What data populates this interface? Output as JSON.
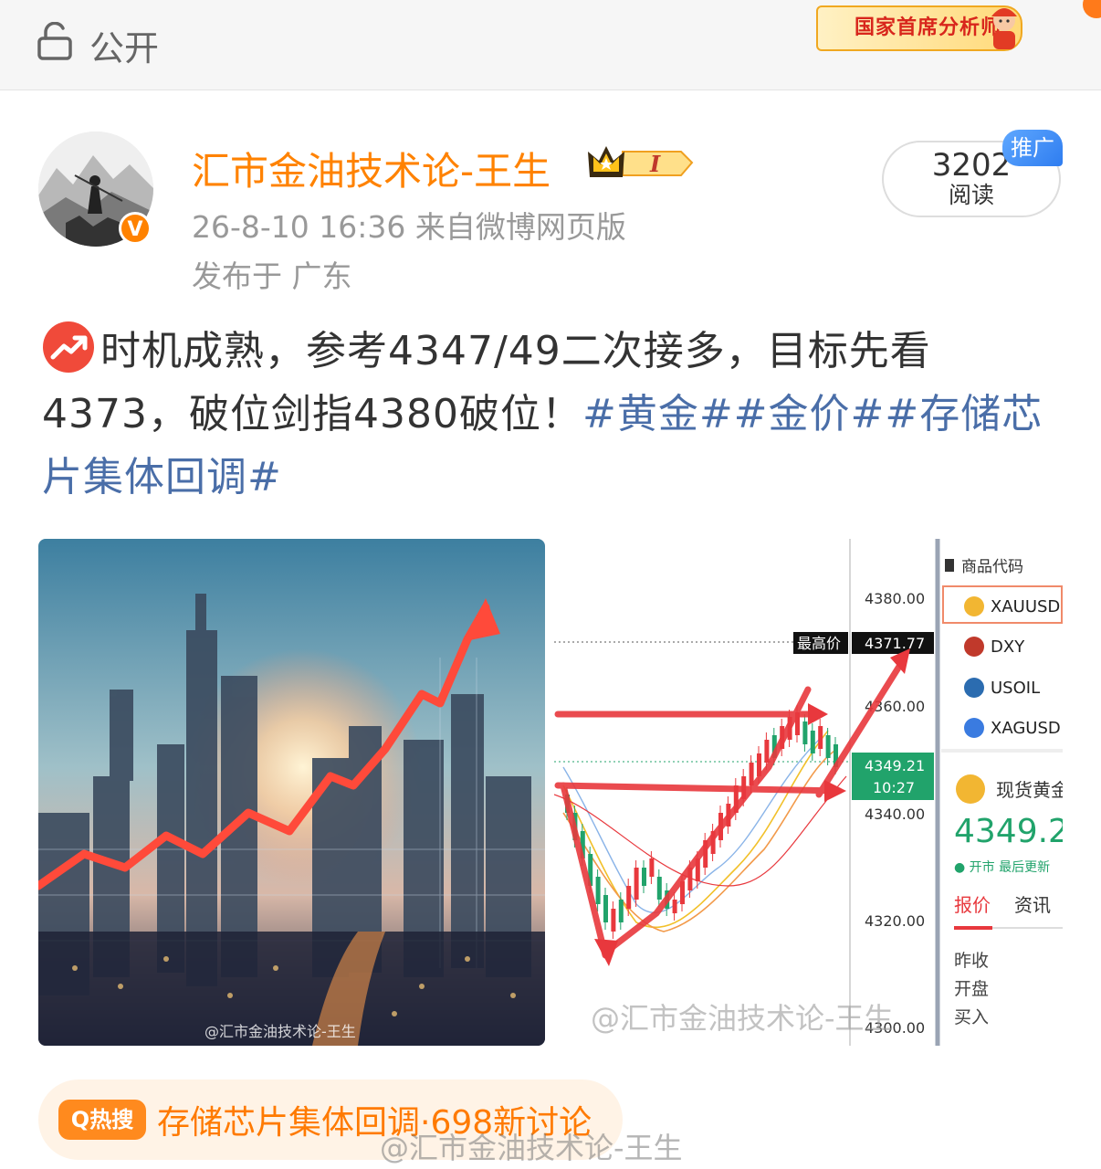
{
  "topbar": {
    "visibility_label": "公开",
    "rank_banner": "国家首席分析师"
  },
  "author": {
    "name": "汇市金油技术论-王生",
    "vip_level": "I",
    "time_source": "26-8-10 16:36  来自微博网页版",
    "location": "发布于 广东"
  },
  "read_stats": {
    "count": "3202",
    "label": "阅读",
    "promo_tag": "推广"
  },
  "post": {
    "text": "时机成熟，参考4347/49二次接多，目标先看4373，破位剑指4380破位！",
    "hashtags": "#黄金##金价##存储芯片集体回调#"
  },
  "image_left": {
    "watermark": "@汇市金油技术论-王生"
  },
  "chart": {
    "price_ticks": [
      "4380.00",
      "4360.00",
      "4340.00",
      "4320.00",
      "4300.00"
    ],
    "high_label": "最高价",
    "high_value": "4371.77",
    "current_price": "4349.21",
    "current_time": "10:27",
    "watermark": "@汇市金油技术论-王生",
    "side_header": "商品代码",
    "symbols": [
      "XAUUSD",
      "DXY",
      "USOIL",
      "XAGUSD"
    ],
    "spot_label": "现货黄金",
    "spot_price": "4349.2",
    "market_status": "● 开市 最后更新",
    "tab_quote": "报价",
    "tab_news": "资讯",
    "rows": [
      "昨收",
      "开盘",
      "买入"
    ]
  },
  "hot": {
    "badge": "热搜",
    "text": "存储芯片集体回调·698新讨论"
  },
  "watermark_bottom": "@汇市金油技术论-王生",
  "colors": {
    "accent": "#ff8200",
    "hashtag": "#4a6ea8",
    "up": "#e8383d",
    "down": "#21a36b"
  }
}
